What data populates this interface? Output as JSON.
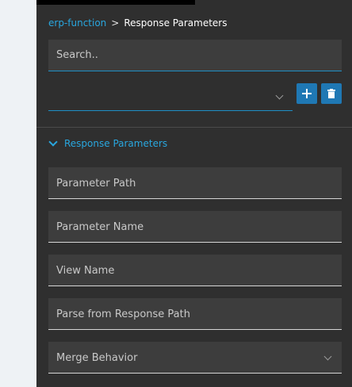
{
  "breadcrumb": {
    "parent": "erp-function",
    "separator": ">",
    "current": "Response Parameters"
  },
  "search": {
    "placeholder": "Search..",
    "value": ""
  },
  "toolbar": {
    "add_icon": "plus-icon",
    "delete_icon": "trash-icon",
    "button_color": "#1f78b4"
  },
  "section": {
    "title": "Response Parameters",
    "expanded": true,
    "accent": "#29a7df"
  },
  "fields": [
    {
      "label": "Parameter Path",
      "value": ""
    },
    {
      "label": "Parameter Name",
      "value": ""
    },
    {
      "label": "View Name",
      "value": ""
    },
    {
      "label": "Parse from Response Path",
      "value": ""
    },
    {
      "label": "Merge Behavior",
      "value": "",
      "type": "select"
    }
  ]
}
